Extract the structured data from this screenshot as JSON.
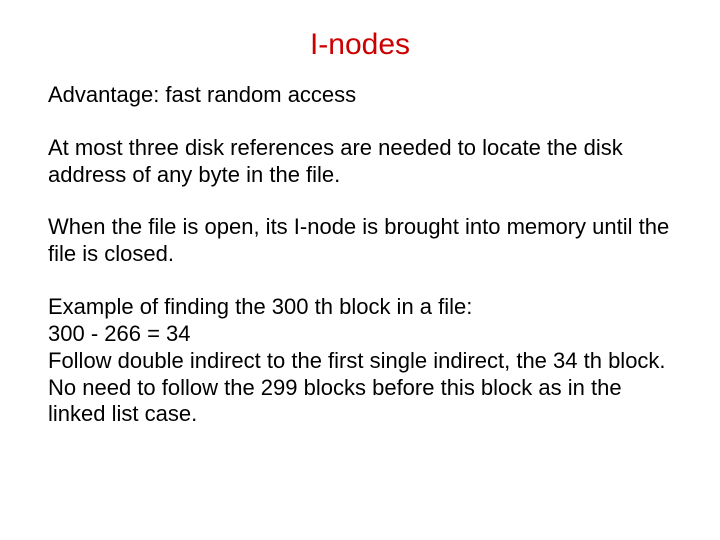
{
  "slide": {
    "title": "I-nodes",
    "paragraphs": {
      "p1": "Advantage: fast random access",
      "p2": "At most three disk references are needed to locate the disk address of any byte in the file.",
      "p3": "When the file is open, its I-node is brought into memory until the file is closed.",
      "p4": "Example of finding the 300 th block in a file:\n300 - 266 = 34\nFollow double indirect to the first single indirect, the 34 th block.\nNo need to follow the 299 blocks before this block as in the linked list case."
    }
  }
}
